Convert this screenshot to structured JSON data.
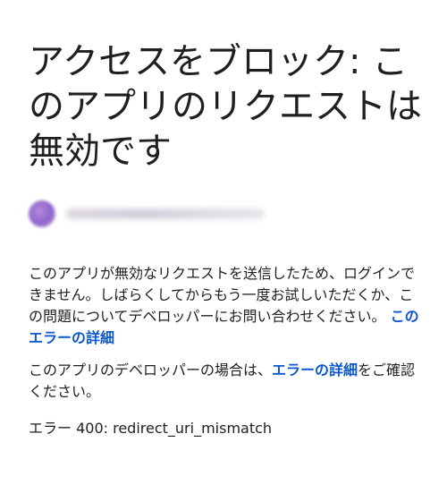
{
  "title": "アクセスをブロック: このアプリのリクエストは無効です",
  "account": {
    "email": "user@gmail.com"
  },
  "message": {
    "part1": "このアプリが無効なリクエストを送信したため、ログインできません。しばらくしてからもう一度お試しいただくか、この問題についてデベロッパーにお問い合わせください。",
    "link1": "このエラーの詳細"
  },
  "developer_note": {
    "part1": "このアプリのデベロッパーの場合は、",
    "link": "エラーの詳細",
    "part2": "をご確認ください。"
  },
  "error": "エラー 400: redirect_uri_mismatch",
  "colors": {
    "text": "#1f1f1f",
    "link": "#0b57d0",
    "background": "#ffffff"
  }
}
